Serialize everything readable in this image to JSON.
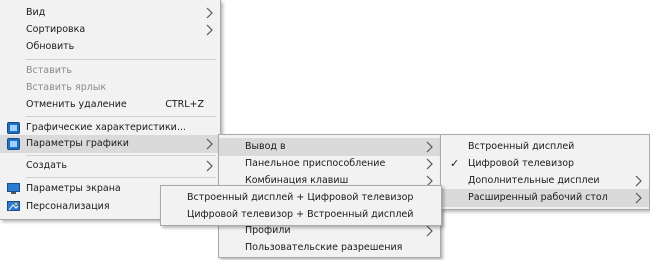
{
  "context_menu": {
    "items": [
      {
        "label": "Вид"
      },
      {
        "label": "Сортировка"
      },
      {
        "label": "Обновить"
      },
      {
        "label": "Вставить"
      },
      {
        "label": "Вставить ярлык"
      },
      {
        "label": "Отменить удаление",
        "shortcut": "CTRL+Z"
      },
      {
        "label": "Графические характеристики..."
      },
      {
        "label": "Параметры графики"
      },
      {
        "label": "Создать"
      },
      {
        "label": "Параметры экрана"
      },
      {
        "label": "Персонализация"
      }
    ]
  },
  "graphics_submenu": {
    "items": [
      {
        "label": "Вывод в"
      },
      {
        "label": "Панельное приспособление"
      },
      {
        "label": "Комбинация клавиш"
      },
      {
        "label": "Профили"
      },
      {
        "label": "Пользовательские разрешения"
      }
    ]
  },
  "output_submenu": {
    "items": [
      {
        "label": "Встроенный дисплей"
      },
      {
        "label": "Цифровой телевизор",
        "checked": true
      },
      {
        "label": "Дополнительные дисплеи"
      },
      {
        "label": "Расширенный рабочий стол"
      }
    ]
  },
  "extended_desktop_submenu": {
    "items": [
      {
        "label": "Встроенный дисплей + Цифровой телевизор"
      },
      {
        "label": "Цифровой телевизор + Встроенный дисплей"
      }
    ]
  },
  "colors": {
    "menu_bg": "#f2f2f2",
    "highlight": "#dadada",
    "disabled_text": "#8b8b8b",
    "icon_blue": "#1f6fc5"
  }
}
